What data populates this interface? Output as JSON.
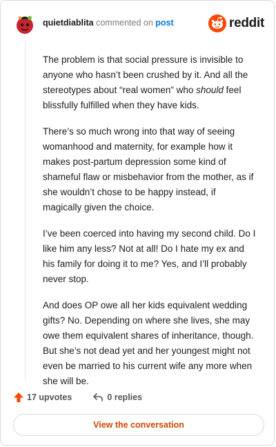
{
  "header": {
    "author": "quietdiablita",
    "commented_on": "commented on",
    "post_label": "post",
    "brand_name": "reddit"
  },
  "comment": {
    "body": {
      "p1_a": "The problem is that social pressure is invisible to anyone who hasn’t been crushed by it. And all the stereotypes about “real women” who ",
      "p1_em": "should",
      "p1_b": " feel blissfully fulfilled when they have kids.",
      "p2": "There’s so much wrong into that way of seeing womanhood and maternity, for example how it makes post-partum depression some kind of shameful flaw or misbehavior from the mother, as if she wouldn’t chose to be happy instead, if magically given the choice.",
      "p3": "I’ve been coerced into having my second child. Do I like him any less? Not at all! Do I hate my ex and his family for doing it to me? Yes, and I’ll probably never stop.",
      "p4": "And does OP owe all her kids equivalent wedding gifts? No. Depending on where she lives, she may owe them equivalent shares of inheritance, though. But she’s not dead yet and her youngest might not even be married to his current wife any more when she will be."
    }
  },
  "actions": {
    "upvotes": "17 upvotes",
    "replies": "0 replies",
    "view_conversation": "View the conversation"
  },
  "icons": {
    "avatar": "avatar-icon",
    "brand": "reddit-logo-icon",
    "upvote": "upvote-arrow-icon",
    "reply": "reply-arrow-icon"
  },
  "colors": {
    "accent": "#ff4500",
    "link": "#0079d3",
    "button_text": "#cc4a00"
  }
}
